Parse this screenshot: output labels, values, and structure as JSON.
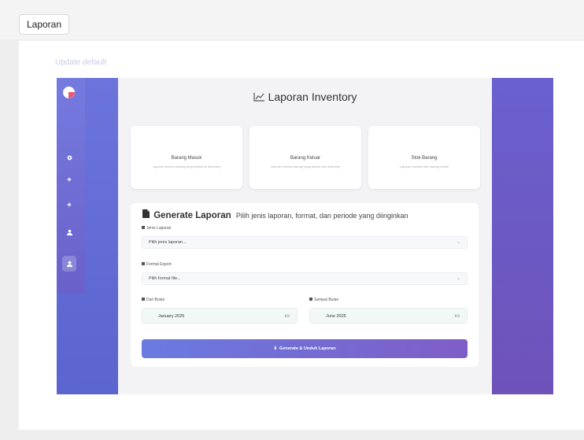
{
  "tab": {
    "label": "Laporan"
  },
  "breadcrumb": "Update default",
  "sidebar": {
    "icons": [
      "settings-icon",
      "plus-icon",
      "plus-icon",
      "users-icon",
      "user-icon"
    ]
  },
  "header": {
    "title": "Laporan Inventory"
  },
  "cards": [
    {
      "title": "Barang Masuk",
      "desc": "Laporan semua barang yang masuk ke inventory"
    },
    {
      "title": "Barang Keluar",
      "desc": "Laporan semua barang yang keluar dari inventory"
    },
    {
      "title": "Stok Barang",
      "desc": "Laporan kondisi stok barang terkini"
    }
  ],
  "generate": {
    "title": "Generate Laporan",
    "subtitle": "Pilih jenis laporan, format, dan periode yang diinginkan",
    "jenis_label": "Jenis Laporan",
    "jenis_value": "Pilih jenis laporan...",
    "format_label": "Format Export",
    "format_value": "Pilih format file...",
    "dari_label": "Dari Bulan",
    "dari_value": "January 2025",
    "sampai_label": "Sampai Bulan",
    "sampai_value": "June 2025",
    "submit": "Generate & Unduh Laporan"
  },
  "colors": {
    "accent": "#6a7be0",
    "accent2": "#7f5dc6"
  }
}
